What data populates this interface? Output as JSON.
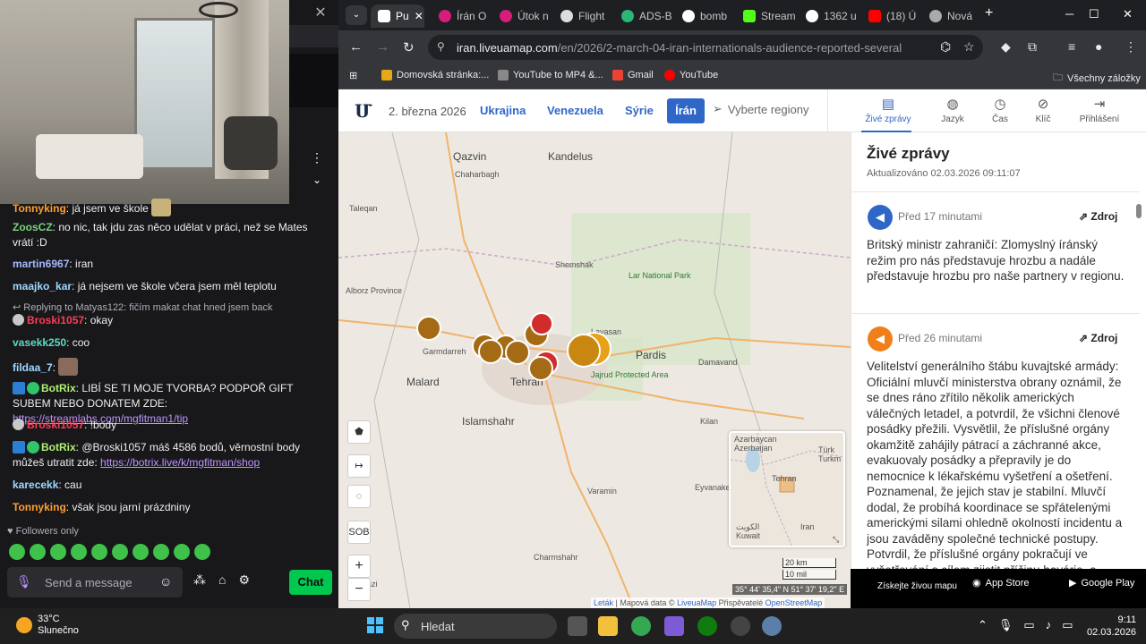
{
  "chat": {
    "messages": [
      {
        "user": "Tonnyking",
        "text": ": já jsem ve škole"
      },
      {
        "user": "ZoosCZ",
        "text": ": no nic, tak jdu zas něco udělat v práci, než se Mates vrátí :D"
      },
      {
        "user": "martin6967",
        "text": ": iran"
      },
      {
        "user": "maajko_kar",
        "text": ": já nejsem ve škole včera jsem měl teplotu"
      },
      {
        "reply": "Replying to Matyas122: fičím makat chat hned jsem back",
        "user": "Broski1057",
        "text": ": okay"
      },
      {
        "user": "vasekk250",
        "text": ": coo"
      },
      {
        "user": "fildaa_7",
        "text": ":"
      },
      {
        "user": "BotRix",
        "text": ": LIBÍ SE TI MOJE TVORBA? PODPOŘ GIFT SUBEM NEBO DONATEM ZDE: ",
        "link": "https://streamlabs.com/mgfitman1/tip"
      },
      {
        "user": "Broski1057",
        "text": ": !body"
      },
      {
        "user": "BotRix",
        "text": ": @Broski1057 máš 4586 bodů, věrnostní body můžeš utratit zde: ",
        "link": "https://botrix.live/k/mgfitman/shop"
      },
      {
        "user": "karecekk",
        "text": ": cau"
      },
      {
        "user": "Tonnyking",
        "text": ": však jsou jarní prázdniny"
      }
    ],
    "followers_only": "Followers only",
    "input_placeholder": "Send a message",
    "chat_button": "Chat"
  },
  "browser": {
    "tabs": [
      {
        "label": "Pu",
        "active": true
      },
      {
        "label": "Írán O"
      },
      {
        "label": "Útok n"
      },
      {
        "label": "Flight"
      },
      {
        "label": "ADS-B"
      },
      {
        "label": "bomb"
      },
      {
        "label": "Stream"
      },
      {
        "label": "1362 u"
      },
      {
        "label": "(18) Ú"
      },
      {
        "label": "Nová"
      }
    ],
    "url_host": "iran.liveuamap.com",
    "url_path": "/en/2026/2-march-04-iran-internationals-audience-reported-several",
    "bookmarks": [
      "Domovská stránka:...",
      "YouTube to MP4 &...",
      "Gmail",
      "YouTube"
    ],
    "all_bookmarks": "Všechny záložky"
  },
  "site": {
    "date": "2. března 2026",
    "regions": [
      "Ukrajina",
      "Venezuela",
      "Sýrie",
      "Írán"
    ],
    "select_regions": "Vyberte regiony",
    "nav": [
      "Živé zprávy",
      "Jazyk",
      "Čas",
      "Klíč",
      "Přihlášení"
    ]
  },
  "map": {
    "labels": [
      "Qazvin",
      "Kandelus",
      "Chaharbagh",
      "Taleqan",
      "Alborz Province",
      "Shemshak",
      "Lar National Park",
      "Lavasan",
      "Pardis",
      "Garmdarreh",
      "Malard",
      "Tehran",
      "Jajrud Protected Area",
      "Damavand",
      "Islamshahr",
      "Eyvanakey",
      "Kilan",
      "Varamin",
      "Charmshahr",
      "Markazi"
    ],
    "tools": [
      "SOB"
    ],
    "scale_km": "20 km",
    "scale_mi": "10 mil",
    "coords": "35° 44' 35,4\" N 51° 37' 19,2\" E",
    "attribution_leaflet": "Leták",
    "attribution_rest": "| Mapová data ©",
    "attribution_lum": "LiveuaMap",
    "attribution_contrib": "Přispěvatelé",
    "attribution_osm": "OpenStreetMap",
    "minimap_labels": [
      "Azarbaycan",
      "Azerbaijan",
      "Türk",
      "Turkm",
      "Tehran",
      "Iran",
      "Kuwait",
      "الكويت"
    ]
  },
  "feed": {
    "title": "Živé zprávy",
    "updated": "Aktualizováno 02.03.2026 09:11:07",
    "items": [
      {
        "time": "Před 17 minutami",
        "source": "Zdroj",
        "text": "Britský ministr zahraničí: Zlomyslný íránský režim pro nás představuje hrozbu a nadále představuje hrozbu pro naše partnery v regionu.",
        "icon_color": "#2f67c9"
      },
      {
        "time": "Před 26 minutami",
        "source": "Zdroj",
        "text": "Velitelství generálního štábu kuvajtské armády: Oficiální mluvčí ministerstva obrany oznámil, že se dnes ráno zřítilo několik amerických válečných letadel, a potvrdil, že všichni členové posádky přežili. Vysvětlil, že příslušné orgány okamžitě zahájily pátrací a záchranné akce, evakuovaly posádky a přepravily je do nemocnice k lékařskému vyšetření a ošetření. Poznamenal, že jejich stav je stabilní. Mluvčí dodal, že probíhá koordinace se spřátelenými americkými silami ohledně okolností incidentu a jsou zaváděny společné technické postupy. Potvrdil, že příslušné orgány pokračují ve vyšetřování s cílem zjistit příčinu havárie, a",
        "icon_color": "#f07f1a"
      }
    ],
    "app_promo": "Získejte živou mapu",
    "app_store": "App Store",
    "google_play": "Google Play"
  },
  "taskbar": {
    "temp": "33°C",
    "weather": "Slunečno",
    "search": "Hledat",
    "time": "9:11",
    "date": "02.03.2026"
  }
}
